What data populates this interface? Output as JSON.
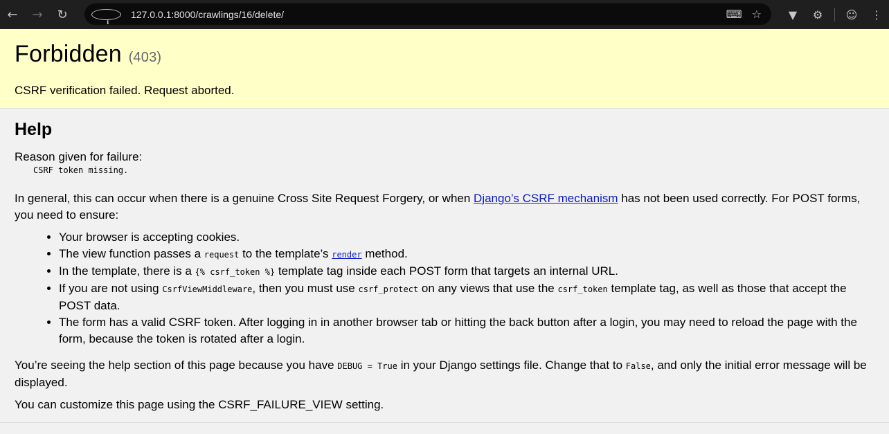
{
  "browser": {
    "url": "127.0.0.1:8000/crawlings/16/delete/"
  },
  "summary": {
    "title": "Forbidden",
    "code": "(403)",
    "message": "CSRF verification failed. Request aborted."
  },
  "help": {
    "heading": "Help",
    "reason_label": "Reason given for failure:",
    "reason": "CSRF token missing.",
    "intro_before": "In general, this can occur when there is a genuine Cross Site Request Forgery, or when ",
    "intro_link": "Django’s CSRF mechanism",
    "intro_after": " has not been used correctly. For POST forms, you need to ensure:",
    "item1": "Your browser is accepting cookies.",
    "item2_a": "The view function passes a ",
    "item2_code": "request",
    "item2_b": " to the template’s ",
    "item2_link": "render",
    "item2_c": " method.",
    "item3_a": "In the template, there is a ",
    "item3_code": "{% csrf_token %}",
    "item3_b": " template tag inside each POST form that targets an internal URL.",
    "item4_a": "If you are not using ",
    "item4_code1": "CsrfViewMiddleware",
    "item4_b": ", then you must use ",
    "item4_code2": "csrf_protect",
    "item4_c": " on any views that use the ",
    "item4_code3": "csrf_token",
    "item4_d": " template tag, as well as those that accept the POST data.",
    "item5": "The form has a valid CSRF token. After logging in in another browser tab or hitting the back button after a login, you may need to reload the page with the form, because the token is rotated after a login.",
    "debug_a": "You’re seeing the help section of this page because you have ",
    "debug_code": "DEBUG = True",
    "debug_b": " in your Django settings file. Change that to ",
    "debug_code2": "False",
    "debug_c": ", and only the initial error message will be displayed.",
    "customize": "You can customize this page using the CSRF_FAILURE_VIEW setting."
  }
}
